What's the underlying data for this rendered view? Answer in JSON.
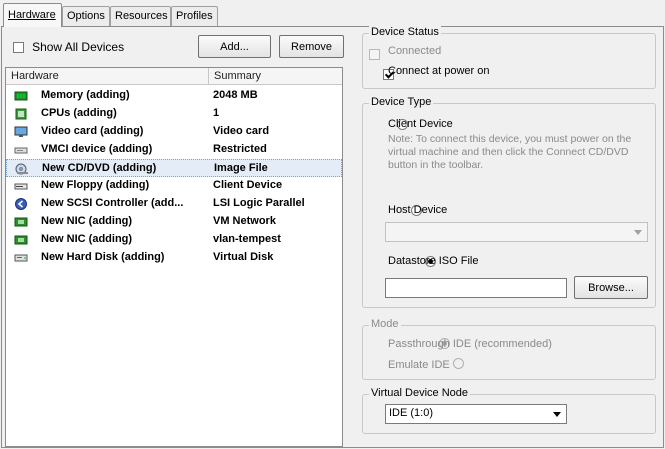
{
  "tabs": [
    {
      "label": "Hardware",
      "active": true
    },
    {
      "label": "Options",
      "active": false
    },
    {
      "label": "Resources",
      "active": false
    },
    {
      "label": "Profiles",
      "active": false
    }
  ],
  "left": {
    "show_all_devices": {
      "label": "Show All Devices",
      "checked": false
    },
    "add_button": "Add...",
    "remove_button": "Remove",
    "columns": {
      "hardware": "Hardware",
      "summary": "Summary"
    },
    "rows": [
      {
        "icon": "memory-icon",
        "name": "Memory (adding)",
        "summary": "2048 MB"
      },
      {
        "icon": "cpu-icon",
        "name": "CPUs (adding)",
        "summary": "1"
      },
      {
        "icon": "monitor-icon",
        "name": "Video card  (adding)",
        "summary": "Video card"
      },
      {
        "icon": "vmci-device-icon",
        "name": "VMCI device (adding)",
        "summary": "Restricted"
      },
      {
        "icon": "cd-dvd-icon",
        "name": "New CD/DVD (adding)",
        "summary": "Image File",
        "selected": true
      },
      {
        "icon": "floppy-icon",
        "name": "New Floppy (adding)",
        "summary": "Client Device"
      },
      {
        "icon": "scsi-controller-icon",
        "name": "New SCSI Controller (add...",
        "summary": "LSI Logic Parallel"
      },
      {
        "icon": "nic-icon",
        "name": "New NIC (adding)",
        "summary": "VM Network"
      },
      {
        "icon": "nic-icon",
        "name": "New NIC (adding)",
        "summary": "vlan-tempest"
      },
      {
        "icon": "hard-disk-icon",
        "name": "New Hard Disk (adding)",
        "summary": "Virtual Disk"
      }
    ]
  },
  "device_status": {
    "title": "Device Status",
    "connected": {
      "label": "Connected",
      "checked": false,
      "enabled": false
    },
    "connect_at_power_on": {
      "label": "Connect at power on",
      "checked": true,
      "enabled": true
    }
  },
  "device_type": {
    "title": "Device Type",
    "client_device": {
      "label": "Client Device",
      "selected": false
    },
    "client_note": [
      "Note: To connect this device, you must power on the",
      "virtual machine and then click the Connect CD/DVD",
      "button in the toolbar."
    ],
    "host_device": {
      "label": "Host Device",
      "selected": false,
      "value": ""
    },
    "datastore_iso": {
      "label": "Datastore ISO File",
      "selected": true,
      "value": ""
    },
    "browse_button": "Browse..."
  },
  "mode": {
    "title": "Mode",
    "passthrough": {
      "label": "Passthrough IDE (recommended)",
      "selected": true
    },
    "emulate": {
      "label": "Emulate IDE",
      "selected": false
    }
  },
  "virtual_device_node": {
    "title": "Virtual Device Node",
    "selected_value": "IDE (1:0)"
  },
  "colors": {
    "selection_bg": "#e4ecf7",
    "selection_border": "#7da2ce",
    "disabled_text": "#8a8a8a"
  }
}
